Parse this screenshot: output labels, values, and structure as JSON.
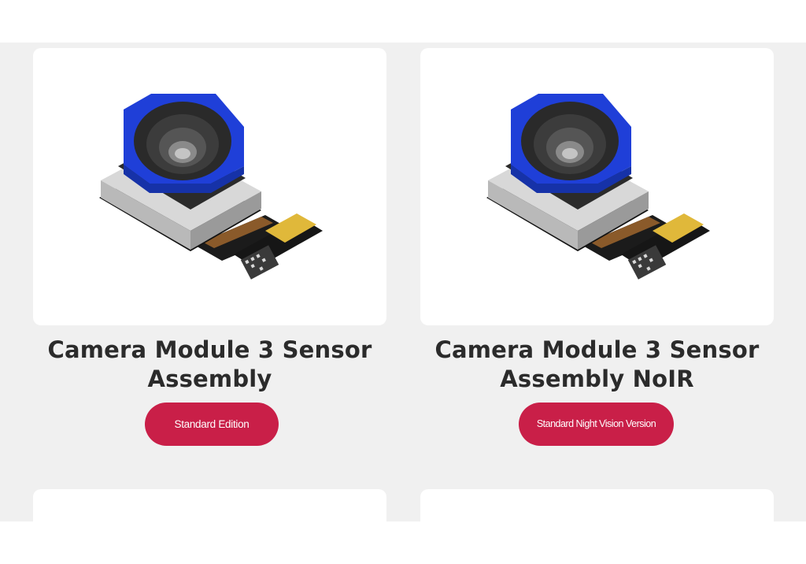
{
  "products": [
    {
      "title": "Camera Module 3 Sensor Assembly",
      "edition_label": "Standard Edition"
    },
    {
      "title": "Camera Module 3 Sensor Assembly NoIR",
      "edition_label": "Standard Night Vision Version"
    }
  ],
  "colors": {
    "page_background": "#f0f0f0",
    "card_background": "#ffffff",
    "title_text": "#2b2b2b",
    "pill_accent": "#c91f48",
    "lens_housing": "#1f3fd8"
  },
  "icons": {
    "product_image": "camera-module-photo"
  }
}
